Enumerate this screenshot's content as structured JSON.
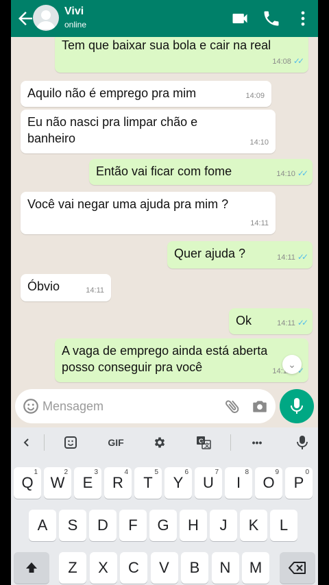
{
  "header": {
    "contact_name": "Vivi",
    "status": "online",
    "color": "#008069"
  },
  "messages": [
    {
      "dir": "out",
      "text": "Tem que baixar sua bola e cair na real",
      "time": "14:08",
      "read": true
    },
    {
      "dir": "in",
      "text": "Aquilo não é emprego pra mim",
      "time": "14:09"
    },
    {
      "dir": "in",
      "text": "Eu não nasci pra limpar chão e\nbanheiro",
      "time": "14:10"
    },
    {
      "dir": "out",
      "text": "Então vai ficar com fome",
      "time": "14:10",
      "read": true
    },
    {
      "dir": "in",
      "text": "Você vai negar uma ajuda pra mim ?",
      "time": "14:11"
    },
    {
      "dir": "out",
      "text": "Quer ajuda ?",
      "time": "14:11",
      "read": true
    },
    {
      "dir": "in",
      "text": "Óbvio",
      "time": "14:11"
    },
    {
      "dir": "out",
      "text": "Ok",
      "time": "14:11",
      "read": true
    },
    {
      "dir": "out",
      "text": "A vaga de emprego ainda está aberta\nposso conseguir pra você",
      "time": "14:12",
      "read": true
    }
  ],
  "composer": {
    "placeholder": "Mensagem",
    "value": ""
  },
  "keyboard": {
    "toolbar": [
      "back-icon",
      "sticker-icon",
      "GIF",
      "settings-icon",
      "translate-icon",
      "more-icon",
      "mic-icon"
    ],
    "gif_label": "GIF",
    "more_label": "•••",
    "row1": [
      {
        "k": "Q",
        "h": "1"
      },
      {
        "k": "W",
        "h": "2"
      },
      {
        "k": "E",
        "h": "3"
      },
      {
        "k": "R",
        "h": "4"
      },
      {
        "k": "T",
        "h": "5"
      },
      {
        "k": "Y",
        "h": "6"
      },
      {
        "k": "U",
        "h": "7"
      },
      {
        "k": "I",
        "h": "8"
      },
      {
        "k": "O",
        "h": "9"
      },
      {
        "k": "P",
        "h": "0"
      }
    ],
    "row2": [
      "A",
      "S",
      "D",
      "F",
      "G",
      "H",
      "J",
      "K",
      "L"
    ],
    "row3": [
      "Z",
      "X",
      "C",
      "V",
      "B",
      "N",
      "M"
    ]
  },
  "colors": {
    "outgoing_bubble": "#DCF8C6",
    "incoming_bubble": "#FFFFFF",
    "read_ticks": "#53bdeb",
    "chat_background": "#ECE5DD",
    "fab": "#00A884"
  }
}
